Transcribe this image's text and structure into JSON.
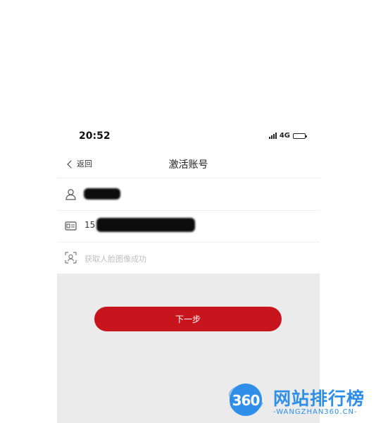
{
  "status_bar": {
    "time": "20:52",
    "network": "4G"
  },
  "nav": {
    "back_label": "返回",
    "title": "激活账号"
  },
  "form": {
    "id_number_prefix": "15",
    "face_status": "获取人脸图像成功"
  },
  "actions": {
    "next_label": "下一步"
  },
  "watermark": {
    "logo_text": "360",
    "title": "网站排行榜",
    "subtitle": "-WANGZHAN360.CN-"
  },
  "colors": {
    "primary_button": "#c8151d",
    "content_background": "#ebebeb",
    "watermark_blue": "#2f8fe8"
  }
}
